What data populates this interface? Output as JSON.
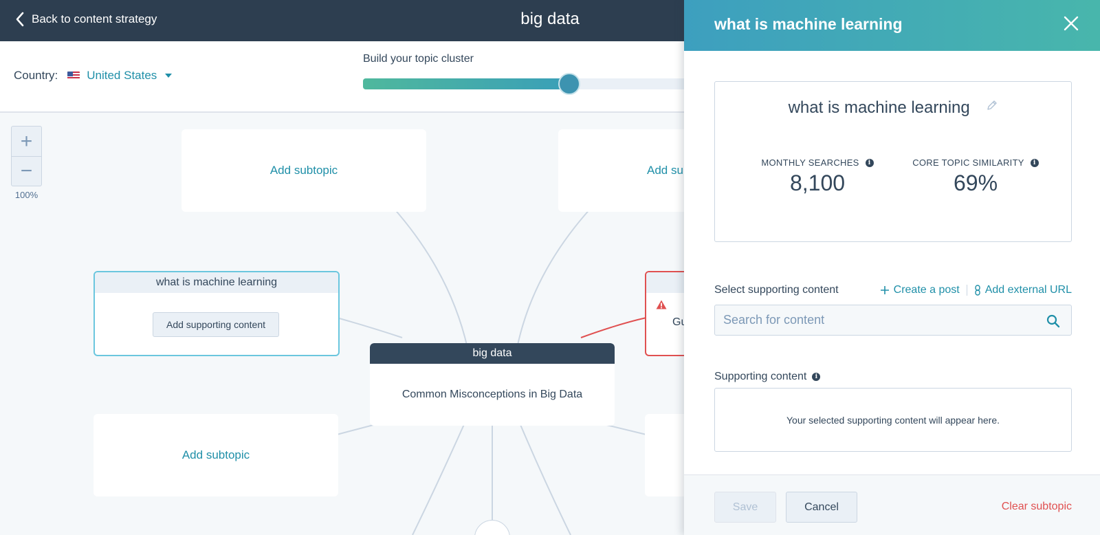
{
  "topbar": {
    "back_label": "Back to content strategy",
    "title": "big data"
  },
  "controls": {
    "country_label": "Country:",
    "country_value": "United States",
    "cluster_label": "Build your topic cluster",
    "cluster_slider_fill": 0.3
  },
  "canvas": {
    "zoom_in": "+",
    "zoom_out": "−",
    "zoom_level": "100%",
    "subtopic_top_left": "Add subtopic",
    "subtopic_top_right": "Add sub",
    "subtopic_bottom_left": "Add subtopic",
    "selected_subtopic": {
      "title": "what is machine learning",
      "button": "Add supporting content"
    },
    "error_subtopic_text": "Gu",
    "core": {
      "title": "big data",
      "pillar": "Common Misconceptions in Big Data"
    }
  },
  "panel": {
    "title": "what is machine learning",
    "keyword": "what is machine learning",
    "metrics": [
      {
        "label": "MONTHLY SEARCHES",
        "value": "8,100"
      },
      {
        "label": "CORE TOPIC SIMILARITY",
        "value": "69%"
      }
    ],
    "select_label": "Select supporting content",
    "create_post": "Create a post",
    "add_external": "Add external URL",
    "search_placeholder": "Search for content",
    "supporting_label": "Supporting content",
    "supporting_empty": "Your selected supporting content will appear here.",
    "save": "Save",
    "cancel": "Cancel",
    "clear": "Clear subtopic"
  },
  "colors": {
    "topbar": "#2d3e50",
    "accent": "#1f8fa8",
    "danger": "#e05050",
    "panel_header_start": "#3d9fbf",
    "panel_header_end": "#48b6ac"
  }
}
